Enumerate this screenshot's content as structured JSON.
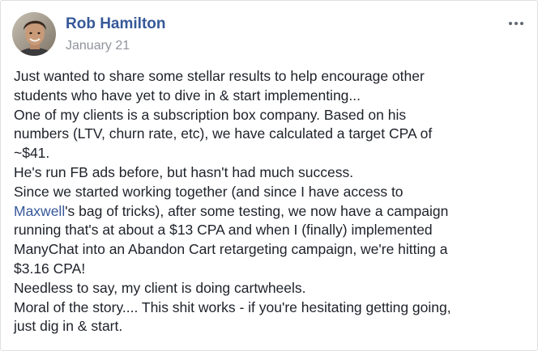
{
  "post": {
    "author": "Rob Hamilton",
    "date": "January 21",
    "options_icon": "more-horizontal-icon",
    "lines": [
      {
        "text": "Just wanted to share some stellar results to help encourage other"
      },
      {
        "text": "students who have yet to dive in & start implementing..."
      },
      {
        "text": "One of my clients is a subscription box company. Based on his"
      },
      {
        "text": "numbers (LTV, churn rate, etc), we have calculated a target CPA of"
      },
      {
        "text": "~$41."
      },
      {
        "text": "He's run FB ads before, but hasn't had much success."
      },
      {
        "text": "Since we started working together (and since I have access to"
      },
      {
        "mention": "Maxwell",
        "rest": "'s bag of tricks), after some testing, we now have a campaign"
      },
      {
        "text": "running that's at about a $13 CPA and when I (finally) implemented"
      },
      {
        "text": "ManyChat into an Abandon Cart retargeting campaign, we're hitting a"
      },
      {
        "text": "$3.16 CPA!"
      },
      {
        "text": "Needless to say, my client is doing cartwheels."
      },
      {
        "text": "Moral of the story.... This shit works - if you're hesitating getting going,"
      },
      {
        "text": "just dig in & start."
      }
    ]
  },
  "colors": {
    "author_link": "#365899",
    "timestamp": "#90949c",
    "body_text": "#1d2129",
    "border": "#dddfe2"
  }
}
